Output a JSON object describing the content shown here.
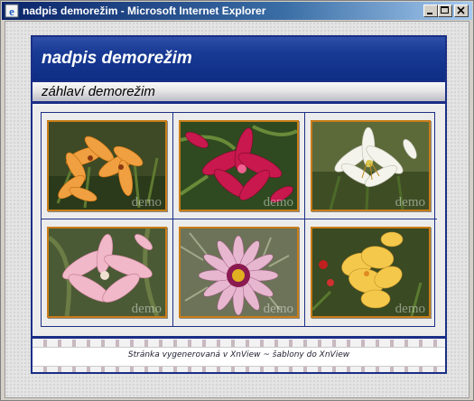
{
  "window": {
    "title": "nadpis demorežim - Microsoft Internet Explorer",
    "controls": [
      "minimize",
      "maximize",
      "close"
    ]
  },
  "page": {
    "header_title": "nadpis demorežim",
    "subheader_title": "záhlaví demorežim",
    "footer_text": "Stránka vygenerovaná v XnView  ~  šablony do XnView",
    "watermark": "demo",
    "colors": {
      "header_blue": "#0e2d84",
      "border_blue": "#1b2f86",
      "thumb_border": "#c97d18"
    }
  },
  "gallery": {
    "thumbnails": [
      {
        "name": "orange-lilies-photo",
        "watermark": "demo"
      },
      {
        "name": "red-lily-photo",
        "watermark": "demo"
      },
      {
        "name": "white-lily-photo",
        "watermark": "demo"
      },
      {
        "name": "pink-lily-photo",
        "watermark": "demo"
      },
      {
        "name": "gazania-photo",
        "watermark": "demo"
      },
      {
        "name": "yellow-gladiolus-photo",
        "watermark": "demo"
      }
    ]
  }
}
